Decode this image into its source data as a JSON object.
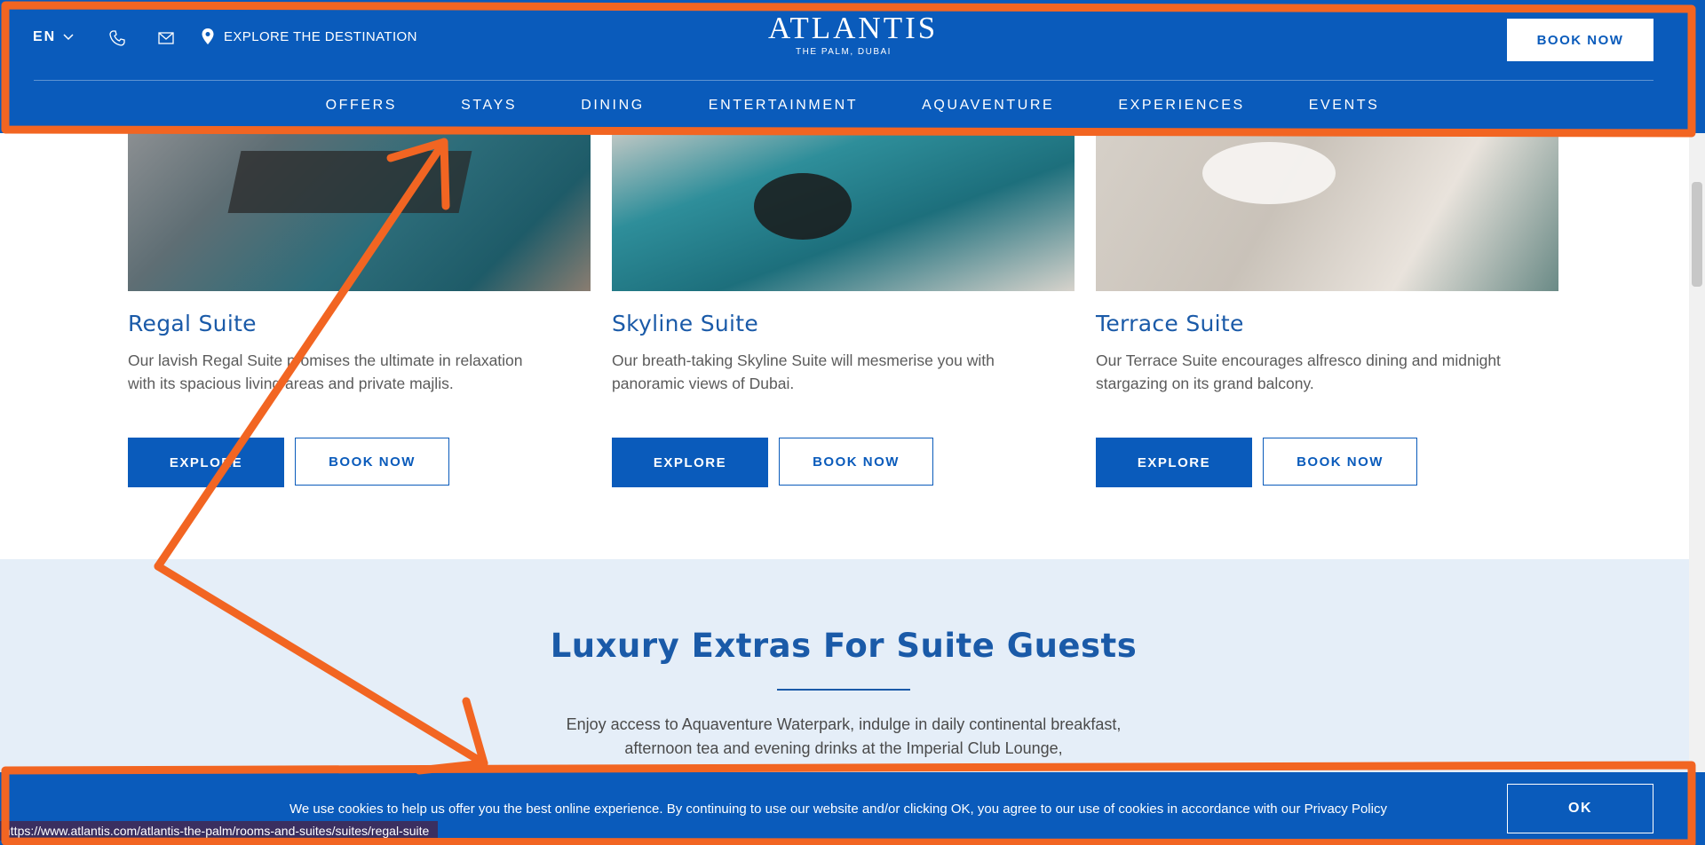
{
  "header": {
    "lang": "EN",
    "explore_destination": "EXPLORE THE DESTINATION",
    "logo_title": "ATLANTIS",
    "logo_subtitle": "THE PALM, DUBAI",
    "book_now": "BOOK NOW",
    "nav": [
      "OFFERS",
      "STAYS",
      "DINING",
      "ENTERTAINMENT",
      "AQUAVENTURE",
      "EXPERIENCES",
      "EVENTS"
    ]
  },
  "suites": [
    {
      "title": "Regal Suite",
      "description": "Our lavish Regal Suite promises the ultimate in relaxation with its spacious living areas and private majlis.",
      "explore": "EXPLORE",
      "book": "BOOK NOW"
    },
    {
      "title": "Skyline Suite",
      "description": "Our breath-taking Skyline Suite will mesmerise you with panoramic views of Dubai.",
      "explore": "EXPLORE",
      "book": "BOOK NOW"
    },
    {
      "title": "Terrace Suite",
      "description": "Our Terrace Suite encourages alfresco dining and midnight stargazing on its grand balcony.",
      "explore": "EXPLORE",
      "book": "BOOK NOW"
    }
  ],
  "extras": {
    "title": "Luxury Extras For Suite Guests",
    "description": "Enjoy access to Aquaventure Waterpark, indulge in daily continental breakfast, afternoon tea and evening drinks at the Imperial Club Lounge,"
  },
  "cookie": {
    "text": "We use cookies to help us offer you the best online experience. By continuing to use our website and/or clicking OK, you agree to our use of cookies in accordance with our Privacy Policy",
    "ok": "OK"
  },
  "status_url": "https://www.atlantis.com/atlantis-the-palm/rooms-and-suites/suites/regal-suite",
  "colors": {
    "brand_blue": "#0a5bbb",
    "heading_blue": "#1a5aa8",
    "light_section": "#e5eef8",
    "annotation_orange": "#f26522"
  },
  "icons": [
    "chevron-down-icon",
    "phone-icon",
    "mail-icon",
    "location-pin-icon"
  ]
}
